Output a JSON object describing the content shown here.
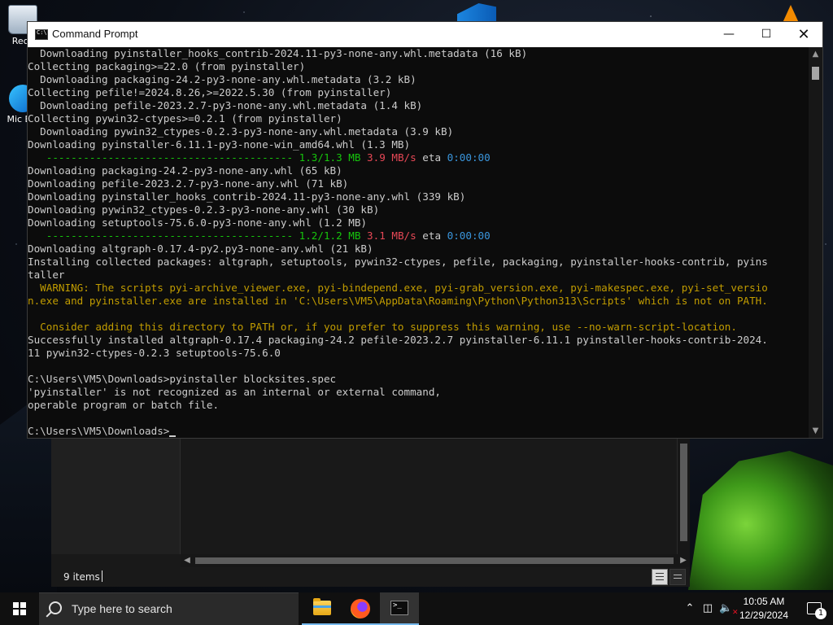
{
  "desktop": {
    "icons": [
      {
        "label": "Recy"
      },
      {
        "label": "Mic E"
      }
    ]
  },
  "cmd_window": {
    "title": "Command Prompt",
    "controls": {
      "minimize": "—",
      "maximize": "☐",
      "close": "✕"
    },
    "lines": [
      [
        {
          "t": "  Downloading pyinstaller_hooks_contrib-2024.11-py3-none-any.whl.metadata (16 kB)"
        }
      ],
      [
        {
          "t": "Collecting packaging>=22.0 (from pyinstaller)"
        }
      ],
      [
        {
          "t": "  Downloading packaging-24.2-py3-none-any.whl.metadata (3.2 kB)"
        }
      ],
      [
        {
          "t": "Collecting pefile!=2024.8.26,>=2022.5.30 (from pyinstaller)"
        }
      ],
      [
        {
          "t": "  Downloading pefile-2023.2.7-py3-none-any.whl.metadata (1.4 kB)"
        }
      ],
      [
        {
          "t": "Collecting pywin32-ctypes>=0.2.1 (from pyinstaller)"
        }
      ],
      [
        {
          "t": "  Downloading pywin32_ctypes-0.2.3-py3-none-any.whl.metadata (3.9 kB)"
        }
      ],
      [
        {
          "t": "Downloading pyinstaller-6.11.1-py3-none-win_amd64.whl (1.3 MB)"
        }
      ],
      [
        {
          "t": "   ",
          "c": ""
        },
        {
          "t": "---------------------------------------- ",
          "c": "c-green"
        },
        {
          "t": "1.3/1.3 MB",
          "c": "c-green"
        },
        {
          "t": " "
        },
        {
          "t": "3.9 MB/s",
          "c": "c-red"
        },
        {
          "t": " eta "
        },
        {
          "t": "0:00:00",
          "c": "c-blue"
        }
      ],
      [
        {
          "t": "Downloading packaging-24.2-py3-none-any.whl (65 kB)"
        }
      ],
      [
        {
          "t": "Downloading pefile-2023.2.7-py3-none-any.whl (71 kB)"
        }
      ],
      [
        {
          "t": "Downloading pyinstaller_hooks_contrib-2024.11-py3-none-any.whl (339 kB)"
        }
      ],
      [
        {
          "t": "Downloading pywin32_ctypes-0.2.3-py3-none-any.whl (30 kB)"
        }
      ],
      [
        {
          "t": "Downloading setuptools-75.6.0-py3-none-any.whl (1.2 MB)"
        }
      ],
      [
        {
          "t": "   ",
          "c": ""
        },
        {
          "t": "---------------------------------------- ",
          "c": "c-green"
        },
        {
          "t": "1.2/1.2 MB",
          "c": "c-green"
        },
        {
          "t": " "
        },
        {
          "t": "3.1 MB/s",
          "c": "c-red"
        },
        {
          "t": " eta "
        },
        {
          "t": "0:00:00",
          "c": "c-blue"
        }
      ],
      [
        {
          "t": "Downloading altgraph-0.17.4-py2.py3-none-any.whl (21 kB)"
        }
      ],
      [
        {
          "t": "Installing collected packages: altgraph, setuptools, pywin32-ctypes, pefile, packaging, pyinstaller-hooks-contrib, pyins"
        }
      ],
      [
        {
          "t": "taller"
        }
      ],
      [
        {
          "t": "  WARNING: The scripts pyi-archive_viewer.exe, pyi-bindepend.exe, pyi-grab_version.exe, pyi-makespec.exe, pyi-set_versio",
          "c": "c-yellow"
        }
      ],
      [
        {
          "t": "n.exe and pyinstaller.exe are installed in 'C:\\Users\\VM5\\AppData\\Roaming\\Python\\Python313\\Scripts' which is not on PATH.",
          "c": "c-yellow"
        }
      ],
      [
        {
          "t": "",
          "c": "c-yellow"
        }
      ],
      [
        {
          "t": "  Consider adding this directory to PATH or, if you prefer to suppress this warning, use --no-warn-script-location.",
          "c": "c-yellow"
        }
      ],
      [
        {
          "t": "Successfully installed altgraph-0.17.4 packaging-24.2 pefile-2023.2.7 pyinstaller-6.11.1 pyinstaller-hooks-contrib-2024."
        }
      ],
      [
        {
          "t": "11 pywin32-ctypes-0.2.3 setuptools-75.6.0"
        }
      ],
      [
        {
          "t": ""
        }
      ],
      [
        {
          "t": "C:\\Users\\VM5\\Downloads>pyinstaller blocksites.spec"
        }
      ],
      [
        {
          "t": "'pyinstaller' is not recognized as an internal or external command,"
        }
      ],
      [
        {
          "t": "operable program or batch file."
        }
      ],
      [
        {
          "t": ""
        }
      ],
      [
        {
          "t": "C:\\Users\\VM5\\Downloads>"
        },
        {
          "cursor": true
        }
      ]
    ]
  },
  "explorer": {
    "status_count": "9 items"
  },
  "taskbar": {
    "search_placeholder": "Type here to search",
    "clock": {
      "time": "10:05 AM",
      "date": "12/29/2024"
    },
    "notification_count": "1"
  }
}
